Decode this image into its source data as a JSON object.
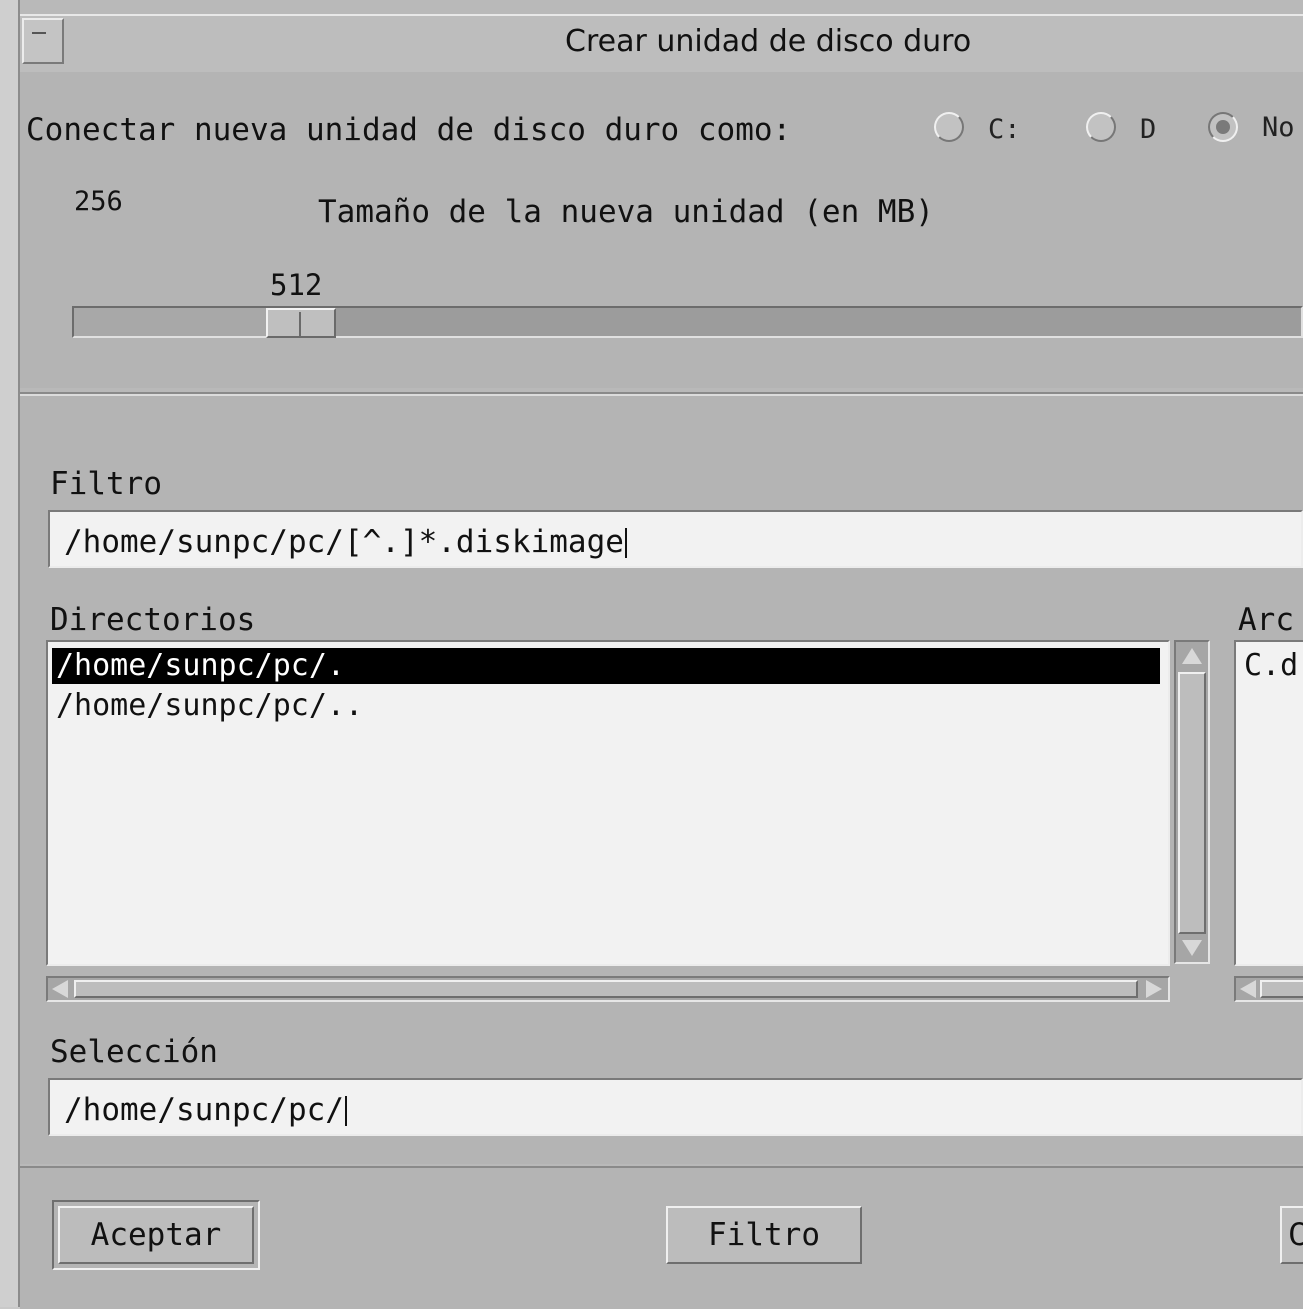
{
  "window": {
    "title": "Crear unidad de disco duro"
  },
  "connect": {
    "label": "Conectar nueva unidad de disco duro como:",
    "options": [
      {
        "label": "C:",
        "selected": false
      },
      {
        "label": "D",
        "selected": false
      },
      {
        "label": "No",
        "selected": true
      }
    ]
  },
  "size": {
    "min_label": "256",
    "label": "Tamaño de la nueva unidad (en MB)",
    "value": "512",
    "value_fraction": 0.16
  },
  "filter": {
    "label": "Filtro",
    "value": "/home/sunpc/pc/[^.]*.diskimage"
  },
  "directories": {
    "label": "Directorios",
    "items": [
      {
        "text": "/home/sunpc/pc/.",
        "selected": true
      },
      {
        "text": "/home/sunpc/pc/..",
        "selected": false
      }
    ]
  },
  "files": {
    "label": "Arc",
    "items": [
      "C.d"
    ]
  },
  "selection": {
    "label": "Selección",
    "value": "/home/sunpc/pc/"
  },
  "buttons": {
    "ok": "Aceptar",
    "filter": "Filtro",
    "cancel": "C"
  }
}
